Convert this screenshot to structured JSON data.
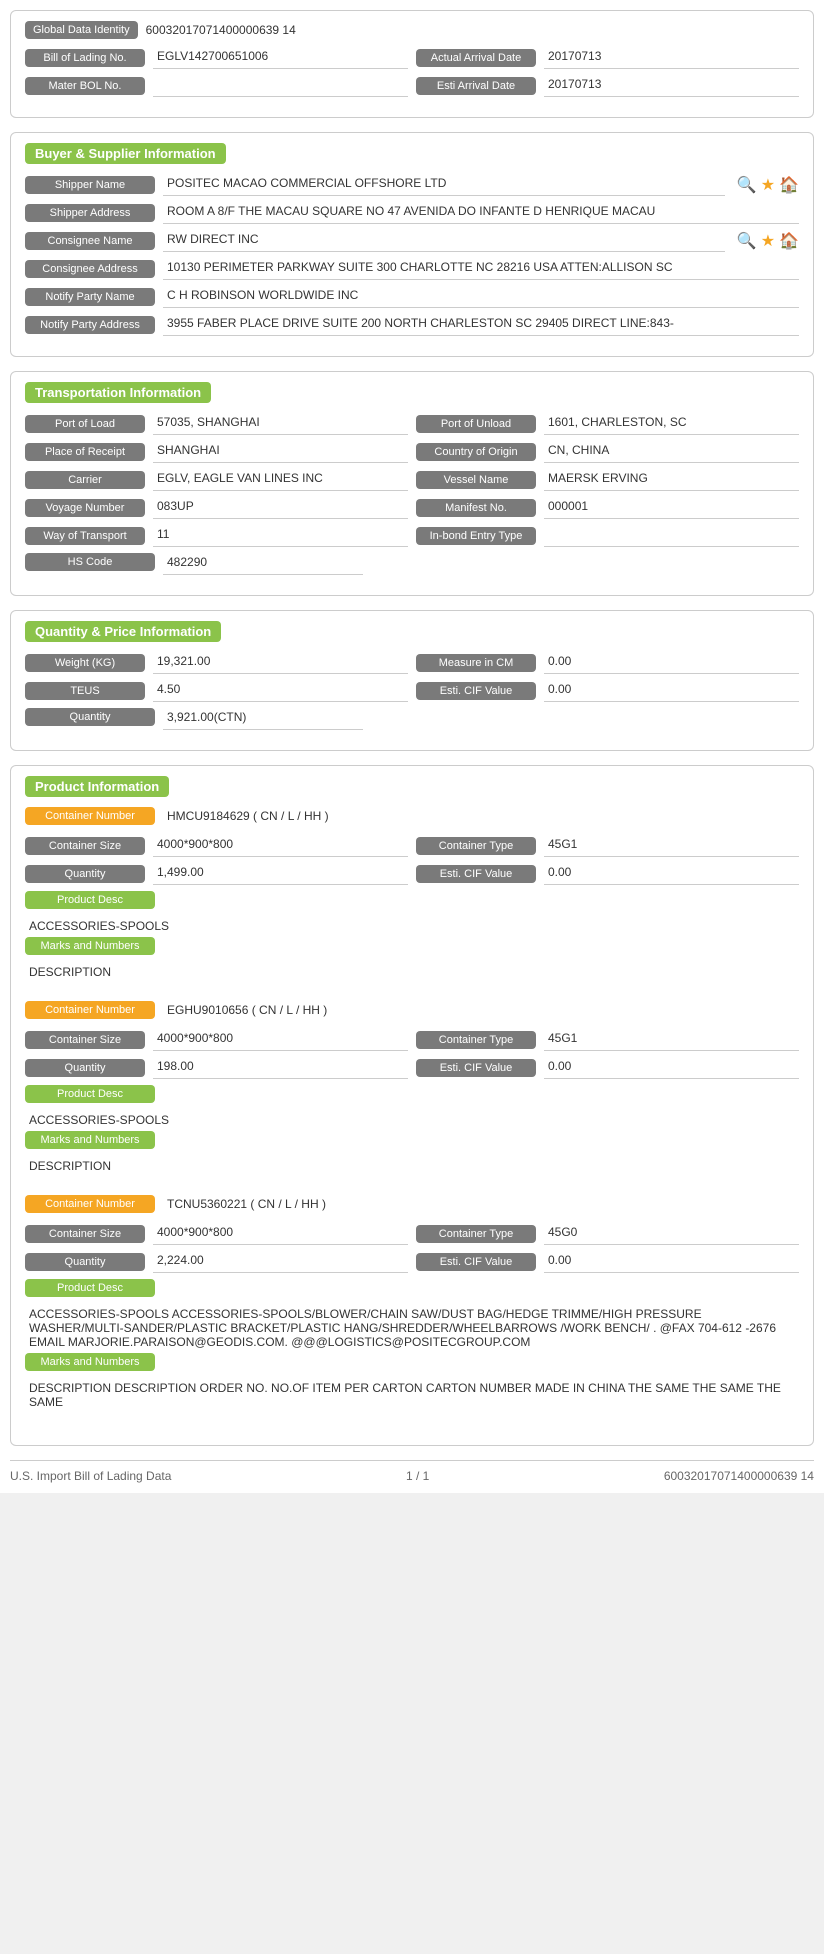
{
  "global": {
    "global_data_identity_label": "Global Data Identity",
    "global_data_identity_value": "60032017071400000639 14",
    "bill_of_lading_label": "Bill of Lading No.",
    "bill_of_lading_value": "EGLV142700651006",
    "actual_arrival_date_label": "Actual Arrival Date",
    "actual_arrival_date_value": "20170713",
    "mater_bol_label": "Mater BOL No.",
    "mater_bol_value": "",
    "esti_arrival_date_label": "Esti Arrival Date",
    "esti_arrival_date_value": "20170713"
  },
  "buyer_supplier": {
    "section_title": "Buyer & Supplier Information",
    "shipper_name_label": "Shipper Name",
    "shipper_name_value": "POSITEC MACAO COMMERCIAL OFFSHORE LTD",
    "shipper_address_label": "Shipper Address",
    "shipper_address_value": "ROOM A 8/F THE MACAU SQUARE NO 47 AVENIDA DO INFANTE D HENRIQUE MACAU",
    "consignee_name_label": "Consignee Name",
    "consignee_name_value": "RW DIRECT INC",
    "consignee_address_label": "Consignee Address",
    "consignee_address_value": "10130 PERIMETER PARKWAY SUITE 300 CHARLOTTE NC 28216 USA ATTEN:ALLISON SC",
    "notify_party_name_label": "Notify Party Name",
    "notify_party_name_value": "C H ROBINSON WORLDWIDE INC",
    "notify_party_address_label": "Notify Party Address",
    "notify_party_address_value": "3955 FABER PLACE DRIVE SUITE 200 NORTH CHARLESTON SC 29405 DIRECT LINE:843-"
  },
  "transportation": {
    "section_title": "Transportation Information",
    "port_of_load_label": "Port of Load",
    "port_of_load_value": "57035, SHANGHAI",
    "port_of_unload_label": "Port of Unload",
    "port_of_unload_value": "1601, CHARLESTON, SC",
    "place_of_receipt_label": "Place of Receipt",
    "place_of_receipt_value": "SHANGHAI",
    "country_of_origin_label": "Country of Origin",
    "country_of_origin_value": "CN, CHINA",
    "carrier_label": "Carrier",
    "carrier_value": "EGLV, EAGLE VAN LINES INC",
    "vessel_name_label": "Vessel Name",
    "vessel_name_value": "MAERSK ERVING",
    "voyage_number_label": "Voyage Number",
    "voyage_number_value": "083UP",
    "manifest_no_label": "Manifest No.",
    "manifest_no_value": "000001",
    "way_of_transport_label": "Way of Transport",
    "way_of_transport_value": "11",
    "in_bond_entry_type_label": "In-bond Entry Type",
    "in_bond_entry_type_value": "",
    "hs_code_label": "HS Code",
    "hs_code_value": "482290"
  },
  "quantity_price": {
    "section_title": "Quantity & Price Information",
    "weight_label": "Weight (KG)",
    "weight_value": "19,321.00",
    "measure_in_cm_label": "Measure in CM",
    "measure_in_cm_value": "0.00",
    "teus_label": "TEUS",
    "teus_value": "4.50",
    "esti_cif_value_label": "Esti. CIF Value",
    "esti_cif_value_value": "0.00",
    "quantity_label": "Quantity",
    "quantity_value": "3,921.00(CTN)"
  },
  "product_information": {
    "section_title": "Product Information",
    "containers": [
      {
        "container_number_label": "Container Number",
        "container_number_value": "HMCU9184629 ( CN / L / HH )",
        "container_size_label": "Container Size",
        "container_size_value": "4000*900*800",
        "container_type_label": "Container Type",
        "container_type_value": "45G1",
        "quantity_label": "Quantity",
        "quantity_value": "1,499.00",
        "esti_cif_label": "Esti. CIF Value",
        "esti_cif_value": "0.00",
        "product_desc_label": "Product Desc",
        "product_desc_value": "ACCESSORIES-SPOOLS",
        "marks_and_numbers_label": "Marks and Numbers",
        "marks_and_numbers_value": "DESCRIPTION"
      },
      {
        "container_number_label": "Container Number",
        "container_number_value": "EGHU9010656 ( CN / L / HH )",
        "container_size_label": "Container Size",
        "container_size_value": "4000*900*800",
        "container_type_label": "Container Type",
        "container_type_value": "45G1",
        "quantity_label": "Quantity",
        "quantity_value": "198.00",
        "esti_cif_label": "Esti. CIF Value",
        "esti_cif_value": "0.00",
        "product_desc_label": "Product Desc",
        "product_desc_value": "ACCESSORIES-SPOOLS",
        "marks_and_numbers_label": "Marks and Numbers",
        "marks_and_numbers_value": "DESCRIPTION"
      },
      {
        "container_number_label": "Container Number",
        "container_number_value": "TCNU5360221 ( CN / L / HH )",
        "container_size_label": "Container Size",
        "container_size_value": "4000*900*800",
        "container_type_label": "Container Type",
        "container_type_value": "45G0",
        "quantity_label": "Quantity",
        "quantity_value": "2,224.00",
        "esti_cif_label": "Esti. CIF Value",
        "esti_cif_value": "0.00",
        "product_desc_label": "Product Desc",
        "product_desc_value": "ACCESSORIES-SPOOLS ACCESSORIES-SPOOLS/BLOWER/CHAIN SAW/DUST BAG/HEDGE TRIMME/HIGH PRESSURE WASHER/MULTI-SANDER/PLASTIC BRACKET/PLASTIC HANG/SHREDDER/WHEELBARROWS /WORK BENCH/ . @FAX 704-612 -2676 EMAIL MARJORIE.PARAISON@GEODIS.COM. @@@LOGISTICS@POSITECGROUP.COM",
        "marks_and_numbers_label": "Marks and Numbers",
        "marks_and_numbers_value": "DESCRIPTION DESCRIPTION ORDER NO. NO.OF ITEM PER CARTON CARTON NUMBER MADE IN CHINA THE SAME THE SAME THE SAME"
      }
    ]
  },
  "footer": {
    "left_text": "U.S. Import Bill of Lading Data",
    "page_text": "1 / 1",
    "right_text": "60032017071400000639 14"
  }
}
